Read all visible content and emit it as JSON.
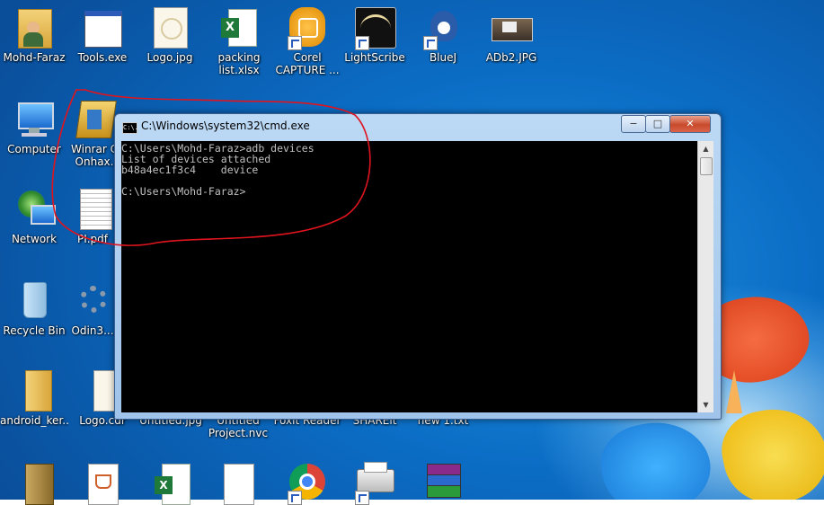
{
  "desktop": {
    "icons": [
      {
        "label": "Mohd-Faraz",
        "icon": "user-folder-icon"
      },
      {
        "label": "Tools.exe",
        "icon": "window-app-icon"
      },
      {
        "label": "Logo.jpg",
        "icon": "image-file-icon"
      },
      {
        "label": "packing\nlist.xlsx",
        "icon": "excel-file-icon"
      },
      {
        "label": "Corel\nCAPTURE ...",
        "icon": "corel-capture-icon"
      },
      {
        "label": "LightScribe",
        "icon": "lightscribe-icon"
      },
      {
        "label": "BlueJ",
        "icon": "bluej-icon"
      },
      {
        "label": "ADb2.JPG",
        "icon": "image-file-icon"
      },
      {
        "label": "Computer",
        "icon": "computer-icon"
      },
      {
        "label": "Winrar C\nOnhax.",
        "icon": "winrar-icon"
      },
      {
        "label": "Network",
        "icon": "network-icon"
      },
      {
        "label": "PI.pdf",
        "icon": "pdf-file-icon"
      },
      {
        "label": "Recycle Bin",
        "icon": "recycle-bin-icon"
      },
      {
        "label": "Odin3...",
        "icon": "odin-gear-icon"
      },
      {
        "label": "android_ker...",
        "icon": "folder-icon"
      },
      {
        "label": "Logo.cdr",
        "icon": "cdr-file-icon"
      },
      {
        "label": "Untitled.jpg",
        "icon": "image-file-icon"
      },
      {
        "label": "Untitled\nProject.nvc",
        "icon": "file-icon"
      },
      {
        "label": "Foxit Reader",
        "icon": "foxit-icon"
      },
      {
        "label": "SHAREit",
        "icon": "shareit-icon"
      },
      {
        "label": "new 1.txt",
        "icon": "text-file-icon"
      },
      {
        "label": "",
        "icon": "folder-icon"
      },
      {
        "label": "",
        "icon": "java-file-icon"
      },
      {
        "label": "",
        "icon": "excel-file-icon"
      },
      {
        "label": "",
        "icon": "blank-file-icon"
      },
      {
        "label": "",
        "icon": "chrome-icon"
      },
      {
        "label": "",
        "icon": "printer-icon"
      },
      {
        "label": "",
        "icon": "winrar-icon"
      }
    ]
  },
  "window": {
    "title": "C:\\Windows\\system32\\cmd.exe",
    "icon_label": "C:\\.",
    "minimize": "−",
    "maximize": "□",
    "close": "✕"
  },
  "console": {
    "lines": [
      "C:\\Users\\Mohd-Faraz>adb devices",
      "List of devices attached",
      "b48a4ec1f3c4    device",
      "",
      "C:\\Users\\Mohd-Faraz>"
    ]
  },
  "colors": {
    "annotation": "#e0141e",
    "console_text": "#c0c0c0",
    "console_bg": "#000000"
  }
}
